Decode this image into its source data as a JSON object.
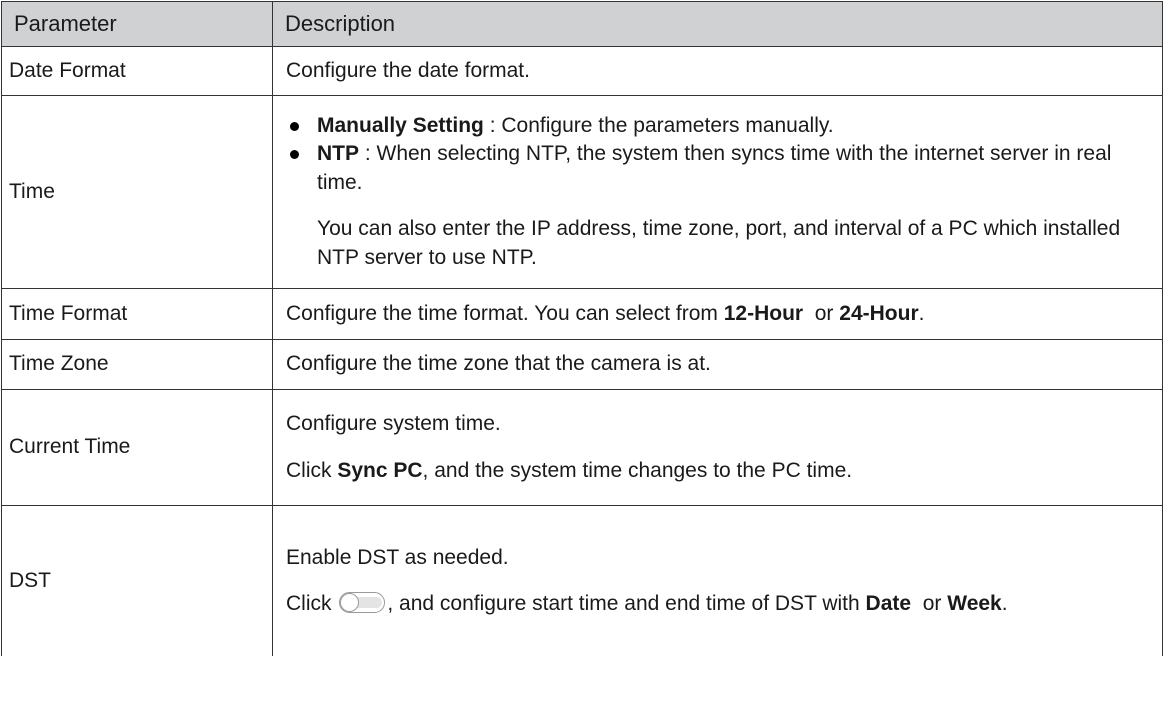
{
  "table": {
    "headers": {
      "parameter": "Parameter",
      "description": "Description"
    },
    "rows": {
      "date_format": {
        "param": "Date Format",
        "desc": "Configure the date format."
      },
      "time": {
        "param": "Time",
        "bullet1_bold": "Manually Setting",
        "bullet1_text": " : Configure the parameters manually.",
        "bullet2_bold": "NTP",
        "bullet2_text": " : When selecting NTP, the system then syncs time with the internet server in real time.",
        "note": "You can also enter the IP address, time zone, port, and interval of a PC which installed NTP server to use NTP."
      },
      "time_format": {
        "param": "Time Format",
        "desc_pre": "Configure the time format. You can select from ",
        "opt1": "12-Hour",
        "mid": "  or ",
        "opt2": "24-Hour",
        "end": "."
      },
      "time_zone": {
        "param": "Time Zone",
        "desc": "Configure the time zone that the camera is at."
      },
      "current_time": {
        "param": "Current Time",
        "line1": "Configure system time.",
        "line2_pre": "Click ",
        "line2_bold": "Sync PC",
        "line2_post": ", and the system time changes to the PC time."
      },
      "dst": {
        "param": "DST",
        "line1": "Enable DST as needed.",
        "line2_pre": "Click ",
        "line2_mid": ", and configure start time and end time of DST with ",
        "opt1": "Date",
        "or_text": "  or ",
        "opt2": "Week",
        "end": ".",
        "toggle_state": "off",
        "toggle_icon": "toggle-switch-icon"
      }
    }
  }
}
